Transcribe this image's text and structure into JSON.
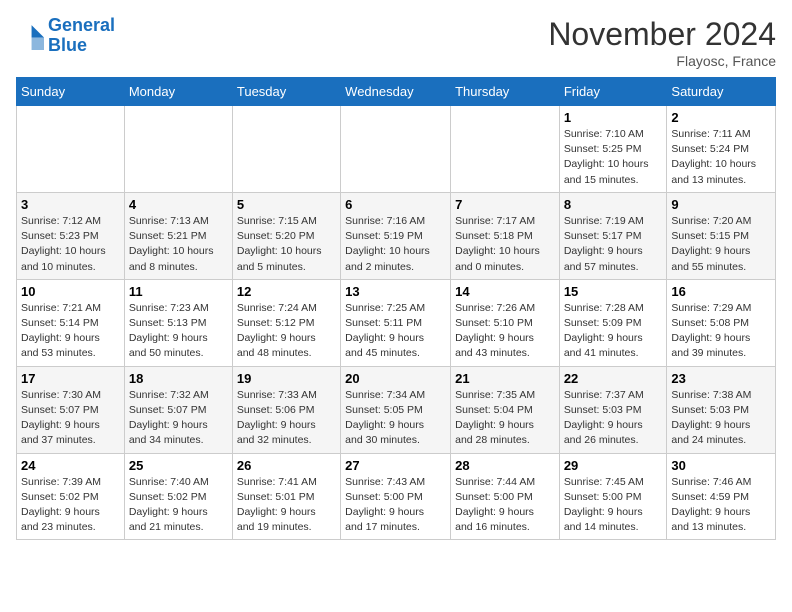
{
  "header": {
    "logo_line1": "General",
    "logo_line2": "Blue",
    "month": "November 2024",
    "location": "Flayosc, France"
  },
  "days_of_week": [
    "Sunday",
    "Monday",
    "Tuesday",
    "Wednesday",
    "Thursday",
    "Friday",
    "Saturday"
  ],
  "weeks": [
    [
      {
        "num": "",
        "info": ""
      },
      {
        "num": "",
        "info": ""
      },
      {
        "num": "",
        "info": ""
      },
      {
        "num": "",
        "info": ""
      },
      {
        "num": "",
        "info": ""
      },
      {
        "num": "1",
        "info": "Sunrise: 7:10 AM\nSunset: 5:25 PM\nDaylight: 10 hours\nand 15 minutes."
      },
      {
        "num": "2",
        "info": "Sunrise: 7:11 AM\nSunset: 5:24 PM\nDaylight: 10 hours\nand 13 minutes."
      }
    ],
    [
      {
        "num": "3",
        "info": "Sunrise: 7:12 AM\nSunset: 5:23 PM\nDaylight: 10 hours\nand 10 minutes."
      },
      {
        "num": "4",
        "info": "Sunrise: 7:13 AM\nSunset: 5:21 PM\nDaylight: 10 hours\nand 8 minutes."
      },
      {
        "num": "5",
        "info": "Sunrise: 7:15 AM\nSunset: 5:20 PM\nDaylight: 10 hours\nand 5 minutes."
      },
      {
        "num": "6",
        "info": "Sunrise: 7:16 AM\nSunset: 5:19 PM\nDaylight: 10 hours\nand 2 minutes."
      },
      {
        "num": "7",
        "info": "Sunrise: 7:17 AM\nSunset: 5:18 PM\nDaylight: 10 hours\nand 0 minutes."
      },
      {
        "num": "8",
        "info": "Sunrise: 7:19 AM\nSunset: 5:17 PM\nDaylight: 9 hours\nand 57 minutes."
      },
      {
        "num": "9",
        "info": "Sunrise: 7:20 AM\nSunset: 5:15 PM\nDaylight: 9 hours\nand 55 minutes."
      }
    ],
    [
      {
        "num": "10",
        "info": "Sunrise: 7:21 AM\nSunset: 5:14 PM\nDaylight: 9 hours\nand 53 minutes."
      },
      {
        "num": "11",
        "info": "Sunrise: 7:23 AM\nSunset: 5:13 PM\nDaylight: 9 hours\nand 50 minutes."
      },
      {
        "num": "12",
        "info": "Sunrise: 7:24 AM\nSunset: 5:12 PM\nDaylight: 9 hours\nand 48 minutes."
      },
      {
        "num": "13",
        "info": "Sunrise: 7:25 AM\nSunset: 5:11 PM\nDaylight: 9 hours\nand 45 minutes."
      },
      {
        "num": "14",
        "info": "Sunrise: 7:26 AM\nSunset: 5:10 PM\nDaylight: 9 hours\nand 43 minutes."
      },
      {
        "num": "15",
        "info": "Sunrise: 7:28 AM\nSunset: 5:09 PM\nDaylight: 9 hours\nand 41 minutes."
      },
      {
        "num": "16",
        "info": "Sunrise: 7:29 AM\nSunset: 5:08 PM\nDaylight: 9 hours\nand 39 minutes."
      }
    ],
    [
      {
        "num": "17",
        "info": "Sunrise: 7:30 AM\nSunset: 5:07 PM\nDaylight: 9 hours\nand 37 minutes."
      },
      {
        "num": "18",
        "info": "Sunrise: 7:32 AM\nSunset: 5:07 PM\nDaylight: 9 hours\nand 34 minutes."
      },
      {
        "num": "19",
        "info": "Sunrise: 7:33 AM\nSunset: 5:06 PM\nDaylight: 9 hours\nand 32 minutes."
      },
      {
        "num": "20",
        "info": "Sunrise: 7:34 AM\nSunset: 5:05 PM\nDaylight: 9 hours\nand 30 minutes."
      },
      {
        "num": "21",
        "info": "Sunrise: 7:35 AM\nSunset: 5:04 PM\nDaylight: 9 hours\nand 28 minutes."
      },
      {
        "num": "22",
        "info": "Sunrise: 7:37 AM\nSunset: 5:03 PM\nDaylight: 9 hours\nand 26 minutes."
      },
      {
        "num": "23",
        "info": "Sunrise: 7:38 AM\nSunset: 5:03 PM\nDaylight: 9 hours\nand 24 minutes."
      }
    ],
    [
      {
        "num": "24",
        "info": "Sunrise: 7:39 AM\nSunset: 5:02 PM\nDaylight: 9 hours\nand 23 minutes."
      },
      {
        "num": "25",
        "info": "Sunrise: 7:40 AM\nSunset: 5:02 PM\nDaylight: 9 hours\nand 21 minutes."
      },
      {
        "num": "26",
        "info": "Sunrise: 7:41 AM\nSunset: 5:01 PM\nDaylight: 9 hours\nand 19 minutes."
      },
      {
        "num": "27",
        "info": "Sunrise: 7:43 AM\nSunset: 5:00 PM\nDaylight: 9 hours\nand 17 minutes."
      },
      {
        "num": "28",
        "info": "Sunrise: 7:44 AM\nSunset: 5:00 PM\nDaylight: 9 hours\nand 16 minutes."
      },
      {
        "num": "29",
        "info": "Sunrise: 7:45 AM\nSunset: 5:00 PM\nDaylight: 9 hours\nand 14 minutes."
      },
      {
        "num": "30",
        "info": "Sunrise: 7:46 AM\nSunset: 4:59 PM\nDaylight: 9 hours\nand 13 minutes."
      }
    ]
  ]
}
